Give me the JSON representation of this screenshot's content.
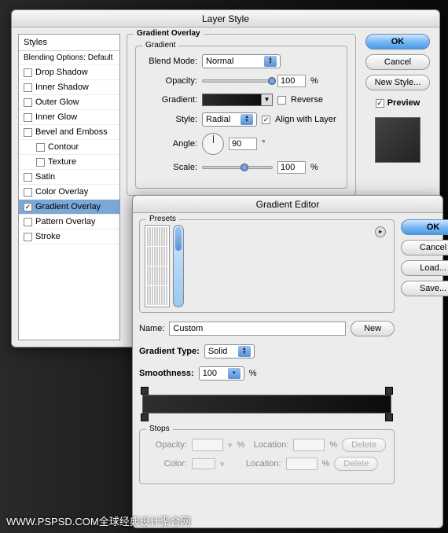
{
  "layerStyle": {
    "title": "Layer Style",
    "stylesHeader": "Styles",
    "blendingDefault": "Blending Options: Default",
    "items": [
      {
        "label": "Drop Shadow",
        "checked": false
      },
      {
        "label": "Inner Shadow",
        "checked": false
      },
      {
        "label": "Outer Glow",
        "checked": false
      },
      {
        "label": "Inner Glow",
        "checked": false
      },
      {
        "label": "Bevel and Emboss",
        "checked": false
      },
      {
        "label": "Contour",
        "checked": false,
        "indent": true
      },
      {
        "label": "Texture",
        "checked": false,
        "indent": true
      },
      {
        "label": "Satin",
        "checked": false
      },
      {
        "label": "Color Overlay",
        "checked": false
      },
      {
        "label": "Gradient Overlay",
        "checked": true,
        "selected": true
      },
      {
        "label": "Pattern Overlay",
        "checked": false
      },
      {
        "label": "Stroke",
        "checked": false
      }
    ],
    "gradientOverlay": {
      "sectionLabel": "Gradient Overlay",
      "gradientLabel": "Gradient",
      "blendModeLabel": "Blend Mode:",
      "blendMode": "Normal",
      "opacityLabel": "Opacity:",
      "opacity": "100",
      "pct": "%",
      "gradientFieldLabel": "Gradient:",
      "reverseLabel": "Reverse",
      "styleLabel": "Style:",
      "style": "Radial",
      "alignLabel": "Align with Layer",
      "angleLabel": "Angle:",
      "angle": "90",
      "deg": "°",
      "scaleLabel": "Scale:",
      "scale": "100"
    },
    "buttons": {
      "ok": "OK",
      "cancel": "Cancel",
      "newStyle": "New Style...",
      "preview": "Preview"
    }
  },
  "gradientEditor": {
    "title": "Gradient Editor",
    "presetsLabel": "Presets",
    "nameLabel": "Name:",
    "name": "Custom",
    "newBtn": "New",
    "typeLabel": "Gradient Type:",
    "type": "Solid",
    "smoothLabel": "Smoothness:",
    "smoothness": "100",
    "pct": "%",
    "stopsLabel": "Stops",
    "opacityLabel": "Opacity:",
    "locationLabel": "Location:",
    "colorLabel": "Color:",
    "deleteLabel": "Delete",
    "buttons": {
      "ok": "OK",
      "cancel": "Cancel",
      "load": "Load...",
      "save": "Save..."
    },
    "presetGradients": [
      "linear-gradient(to right,#000,#fff)",
      "linear-gradient(to right,#000,transparent)",
      "linear-gradient(to right,#000,#fff,#000)",
      "linear-gradient(to right,#fff,#888,#fff)",
      "linear-gradient(45deg,red,orange,yellow)",
      "linear-gradient(45deg,#06f,#fff)",
      "linear-gradient(45deg,#f06,#ff0)",
      "linear-gradient(45deg,#60f,#0ff)",
      "linear-gradient(45deg,#fa0,#f00)",
      "linear-gradient(45deg,#fc6,#c60)",
      "linear-gradient(to right,#a40,#fc8)",
      "linear-gradient(to right,red,orange,yellow,green,blue,violet)",
      "linear-gradient(45deg,#0a0,#8f8)",
      "linear-gradient(45deg,#f0a,#fa0)",
      "linear-gradient(45deg,#00a,#fff)",
      "linear-gradient(45deg,#fa0,#ff0,#fa0)",
      "linear-gradient(45deg,#8f0,#ff0)",
      "linear-gradient(45deg,#f80,#ff0)",
      "linear-gradient(45deg,#ff0,#f80)",
      "linear-gradient(45deg,#c60,#f00)",
      "linear-gradient(45deg,#0cf,#f0c)",
      "linear-gradient(45deg,#808,#f0f)",
      "linear-gradient(45deg,#f0c,#ff0)",
      "repeating-linear-gradient(45deg,#000 0 4px,#fff 4px 8px)",
      "linear-gradient(45deg,#f00,#ff0,#0f0)",
      "linear-gradient(45deg,#c00,#fc0)",
      "linear-gradient(45deg,#fc0,#c00)",
      "linear-gradient(45deg,#aaa,#eee)",
      "linear-gradient(45deg,#c33,#fcc)",
      "linear-gradient(45deg,#c00,#fa0)",
      "linear-gradient(45deg,#0a8,#8fa)",
      "linear-gradient(45deg,#80c,#c8f)",
      "linear-gradient(45deg,#f44,#fff)",
      "linear-gradient(45deg,#ccc,#555)",
      "linear-gradient(45deg,#f84,#fea)",
      "linear-gradient(45deg,#ca0,#ff8)"
    ]
  },
  "watermark": "WWW.PSPSD.COM全球经典设计聚合网"
}
